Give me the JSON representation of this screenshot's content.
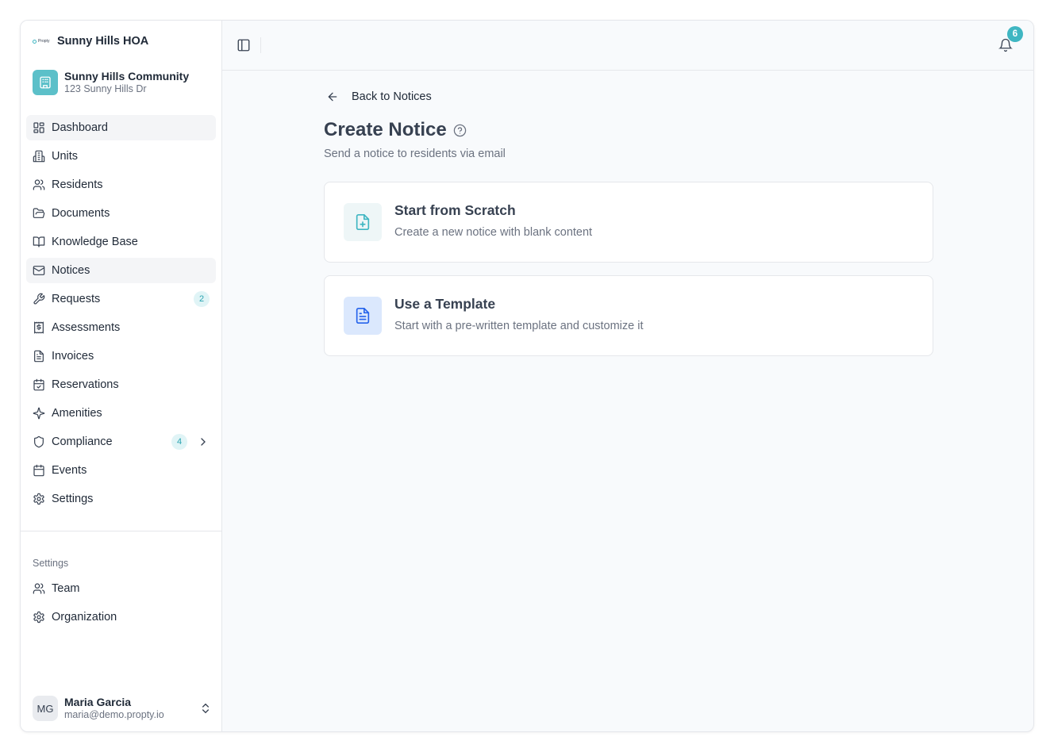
{
  "brand": {
    "logo_text": "Propty",
    "title": "Sunny Hills HOA"
  },
  "community": {
    "name": "Sunny Hills Community",
    "address": "123 Sunny Hills Dr"
  },
  "nav": [
    {
      "label": "Dashboard",
      "icon": "dashboard-icon"
    },
    {
      "label": "Units",
      "icon": "building-icon"
    },
    {
      "label": "Residents",
      "icon": "users-icon"
    },
    {
      "label": "Documents",
      "icon": "folder-icon"
    },
    {
      "label": "Knowledge Base",
      "icon": "book-icon"
    },
    {
      "label": "Notices",
      "icon": "mail-icon",
      "active": true
    },
    {
      "label": "Requests",
      "icon": "wrench-icon",
      "badge": "2"
    },
    {
      "label": "Assessments",
      "icon": "receipt-dollar-icon"
    },
    {
      "label": "Invoices",
      "icon": "file-text-icon"
    },
    {
      "label": "Reservations",
      "icon": "calendar-check-icon"
    },
    {
      "label": "Amenities",
      "icon": "sparkles-icon"
    },
    {
      "label": "Compliance",
      "icon": "shield-icon",
      "badge": "4"
    },
    {
      "label": "Events",
      "icon": "calendar-icon"
    },
    {
      "label": "Settings",
      "icon": "gear-icon"
    }
  ],
  "settings_section": {
    "label": "Settings",
    "items": [
      {
        "label": "Team",
        "icon": "users-icon"
      },
      {
        "label": "Organization",
        "icon": "gear-icon"
      }
    ]
  },
  "user": {
    "initials": "MG",
    "name": "Maria Garcia",
    "email": "maria@demo.propty.io"
  },
  "topbar": {
    "notification_count": "6"
  },
  "page": {
    "back_label": "Back to Notices",
    "title": "Create Notice",
    "subtitle": "Send a notice to residents via email"
  },
  "options": [
    {
      "title": "Start from Scratch",
      "description": "Create a new notice with blank content",
      "icon": "file-plus-icon",
      "icon_bg": "#eef6f7",
      "icon_color": "#3fb6c2"
    },
    {
      "title": "Use a Template",
      "description": "Start with a pre-written template and customize it",
      "icon": "file-text-icon",
      "icon_bg": "#dbe8fd",
      "icon_color": "#2563eb"
    }
  ],
  "colors": {
    "accent": "#3fb6c2",
    "badge_bg": "#e0f4f6",
    "template_blue": "#2563eb"
  }
}
